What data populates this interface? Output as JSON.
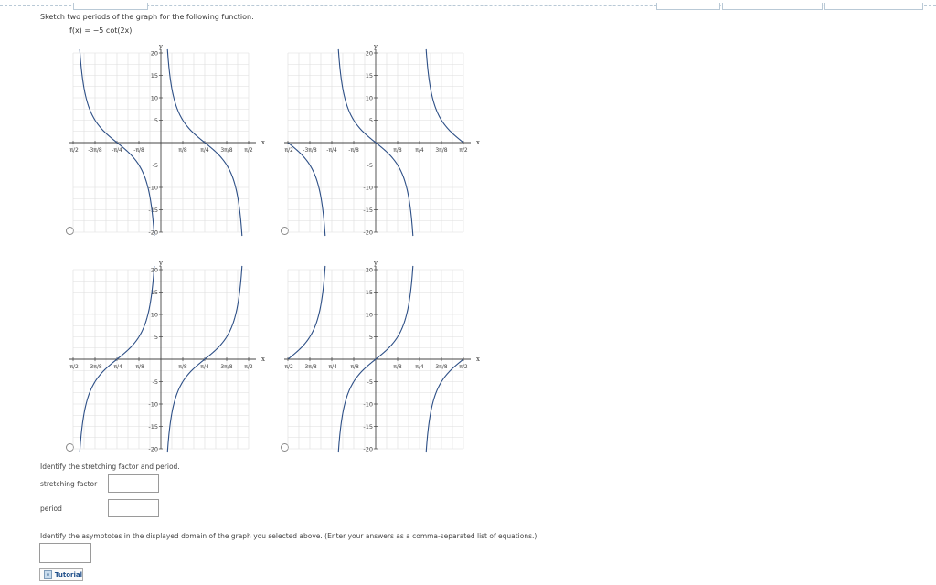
{
  "question": {
    "prompt": "Sketch two periods of the graph for the following function.",
    "function": "f(x) = −5 cot(2x)"
  },
  "graph_options": [
    {
      "id": "A",
      "asymptotes": [
        -0.5,
        0,
        0.5
      ],
      "sign": 1,
      "x_ticks": [
        "-π/2",
        "-3π/8",
        "-π/4",
        "-π/8",
        "π/8",
        "π/4",
        "3π/8",
        "π/2"
      ]
    },
    {
      "id": "B",
      "asymptotes": [
        -0.25,
        0.25
      ],
      "sign": 1,
      "x_ticks": [
        "-π/2",
        "-3π/8",
        "-π/4",
        "-π/8",
        "π/8",
        "π/4",
        "3π/8",
        "π/2"
      ]
    },
    {
      "id": "C",
      "asymptotes": [
        -0.5,
        0,
        0.5
      ],
      "sign": -1,
      "x_ticks": [
        "-π/2",
        "-3π/8",
        "-π/4",
        "-π/8",
        "π/8",
        "π/4",
        "3π/8",
        "π/2"
      ]
    },
    {
      "id": "D",
      "asymptotes": [
        -0.25,
        0.25
      ],
      "sign": -1,
      "x_ticks": [
        "-π/2",
        "-3π/8",
        "-π/4",
        "-π/8",
        "π/8",
        "π/4",
        "3π/8",
        "π/2"
      ]
    }
  ],
  "axis": {
    "x_label": "x",
    "y_label": "y",
    "y_ticks": [
      "20",
      "15",
      "10",
      "5",
      "-5",
      "-10",
      "-15",
      "-20"
    ],
    "xlim_pi": [
      -0.5,
      0.5
    ],
    "ylim": [
      -20,
      20
    ]
  },
  "identify": {
    "prompt": "Identify the stretching factor and period.",
    "stretching_factor_label": "stretching factor",
    "stretching_factor_value": "",
    "period_label": "period",
    "period_value": ""
  },
  "asymptotes_section": {
    "prompt": "Identify the asymptotes in the displayed domain of the graph you selected above. (Enter your answers as a comma-separated list of equations.)",
    "value": ""
  },
  "tutorial": {
    "label": "Tutorial",
    "icon": "tutorial-icon"
  },
  "colors": {
    "curve": "#2d4f86",
    "grid": "#dddddd",
    "axis": "#444444"
  }
}
